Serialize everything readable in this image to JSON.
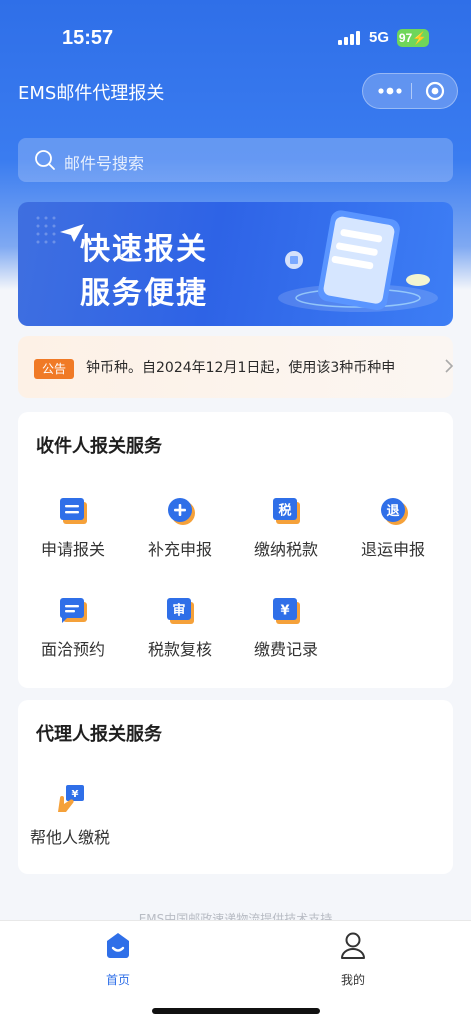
{
  "status": {
    "time": "15:57",
    "network": "5G",
    "battery": "97"
  },
  "nav": {
    "title": "EMS邮件代理报关"
  },
  "search": {
    "placeholder": "邮件号搜索"
  },
  "banner": {
    "line1": "快速报关",
    "line2": "服务便捷"
  },
  "notice": {
    "tag": "公告",
    "text": "钟币种。自2024年12月1日起，使用该3种币种申"
  },
  "recipient_section": {
    "title": "收件人报关服务",
    "items": [
      {
        "label": "申请报关",
        "icon": "form-icon"
      },
      {
        "label": "补充申报",
        "icon": "plus-circle-icon"
      },
      {
        "label": "缴纳税款",
        "icon": "tax-icon",
        "glyph": "税"
      },
      {
        "label": "退运申报",
        "icon": "return-icon",
        "glyph": "退"
      },
      {
        "label": "面洽预约",
        "icon": "chat-icon"
      },
      {
        "label": "税款复核",
        "icon": "review-icon",
        "glyph": "审"
      },
      {
        "label": "缴费记录",
        "icon": "payment-record-icon",
        "glyph": "¥"
      }
    ]
  },
  "agent_section": {
    "title": "代理人报关服务",
    "items": [
      {
        "label": "帮他人缴税",
        "icon": "hand-pay-icon",
        "glyph": "¥"
      }
    ]
  },
  "footer_note": "EMS中国邮政速递物流提供技术支持",
  "tabbar": {
    "items": [
      {
        "label": "首页",
        "icon": "home-icon",
        "active": true
      },
      {
        "label": "我的",
        "icon": "profile-icon",
        "active": false
      }
    ]
  },
  "colors": {
    "primary": "#2f6fe8",
    "accent_orange": "#f07a26",
    "active_tab": "#2f6fe8",
    "inactive_tab": "#333333"
  }
}
